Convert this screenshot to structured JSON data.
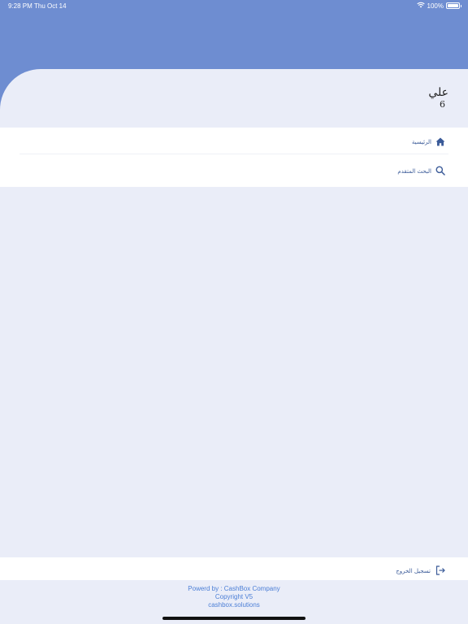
{
  "status_bar": {
    "time": "9:28 PM",
    "date": "Thu Oct 14",
    "battery": "100%",
    "battery_level": 1.0
  },
  "user": {
    "name": "علي",
    "sub": "6"
  },
  "menu": {
    "items": [
      {
        "label": "الرئيسية",
        "icon": "home-icon"
      },
      {
        "label": "البحث المتقدم",
        "icon": "search-icon"
      }
    ]
  },
  "logout": {
    "label": "تسجيل الخروج",
    "icon": "logout-icon"
  },
  "footer": {
    "line1": "Powerd by : CashBox Company",
    "line2": "Copyright V5",
    "line3": "cashbox.solutions"
  },
  "colors": {
    "header": "#6e8dd1",
    "background": "#eaedf8",
    "accent": "#3a5a98",
    "footer_text": "#4c7fd6"
  }
}
